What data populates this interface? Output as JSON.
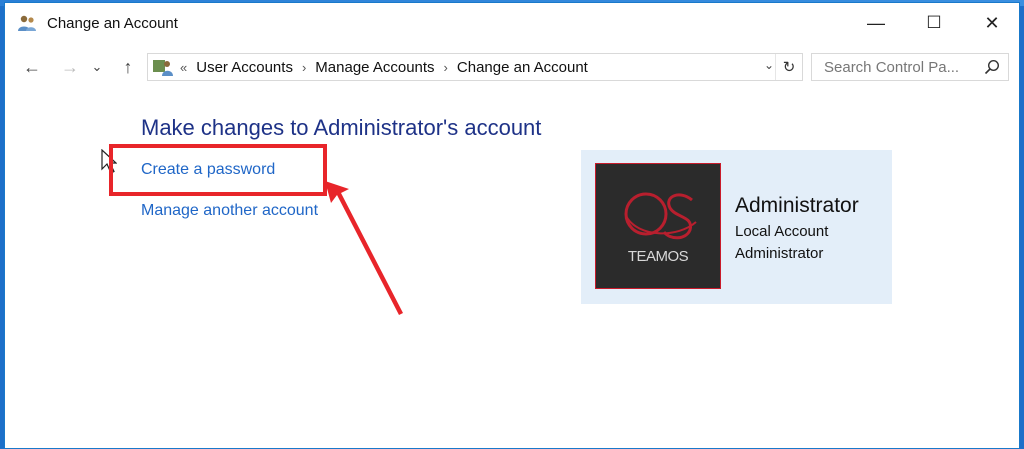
{
  "window": {
    "title": "Change an Account",
    "controls": {
      "minimize": "—",
      "maximize": "☐",
      "close": "✕"
    }
  },
  "nav": {
    "back": "←",
    "forward": "→",
    "recent": "⌄",
    "up": "↑"
  },
  "address": {
    "overflow": "«",
    "crumbs": [
      "User Accounts",
      "Manage Accounts",
      "Change an Account"
    ],
    "separator": "›",
    "dropdown": "⌄",
    "refresh": "↻"
  },
  "search": {
    "placeholder": "Search Control Pa...",
    "value": ""
  },
  "main": {
    "heading": "Make changes to Administrator's account",
    "links": [
      "Create a password",
      "Manage another account"
    ]
  },
  "account": {
    "name": "Administrator",
    "type": "Local Account",
    "role": "Administrator",
    "avatar_label": "TEAMOS"
  },
  "colors": {
    "accent": "#1979ca",
    "link": "#1f66c7",
    "heading": "#1e3287",
    "annotation": "#e8252a",
    "card_bg": "#e3eef9"
  }
}
